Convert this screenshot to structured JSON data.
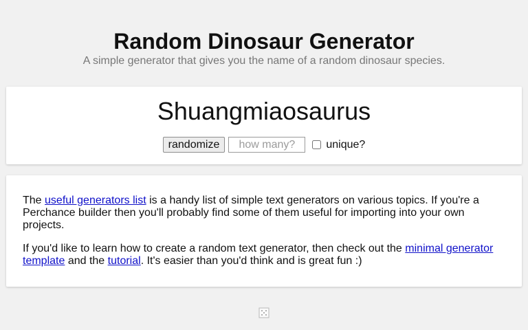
{
  "header": {
    "title": "Random Dinosaur Generator",
    "subtitle": "A simple generator that gives you the name of a random dinosaur species."
  },
  "generator": {
    "result": "Shuangmiaosaurus",
    "randomize_label": "randomize",
    "count_placeholder": "how many?",
    "unique_label": "unique?",
    "unique_checked": false
  },
  "info": {
    "p1_before": "The ",
    "p1_link": "useful generators list",
    "p1_after": " is a handy list of simple text generators on various topics. If you're a Perchance builder then you'll probably find some of them useful for importing into your own projects.",
    "p2_before": "If you'd like to learn how to create a random text generator, then check out the ",
    "p2_link1": "minimal generator template",
    "p2_middle": " and the ",
    "p2_link2": "tutorial",
    "p2_after": ". It's easier than you'd think and is great fun :)"
  },
  "footer": {
    "icon": "dice-icon"
  },
  "colors": {
    "background": "#f1f1f1",
    "card": "#ffffff",
    "link": "#0f10c9",
    "subtitle": "#777777"
  }
}
